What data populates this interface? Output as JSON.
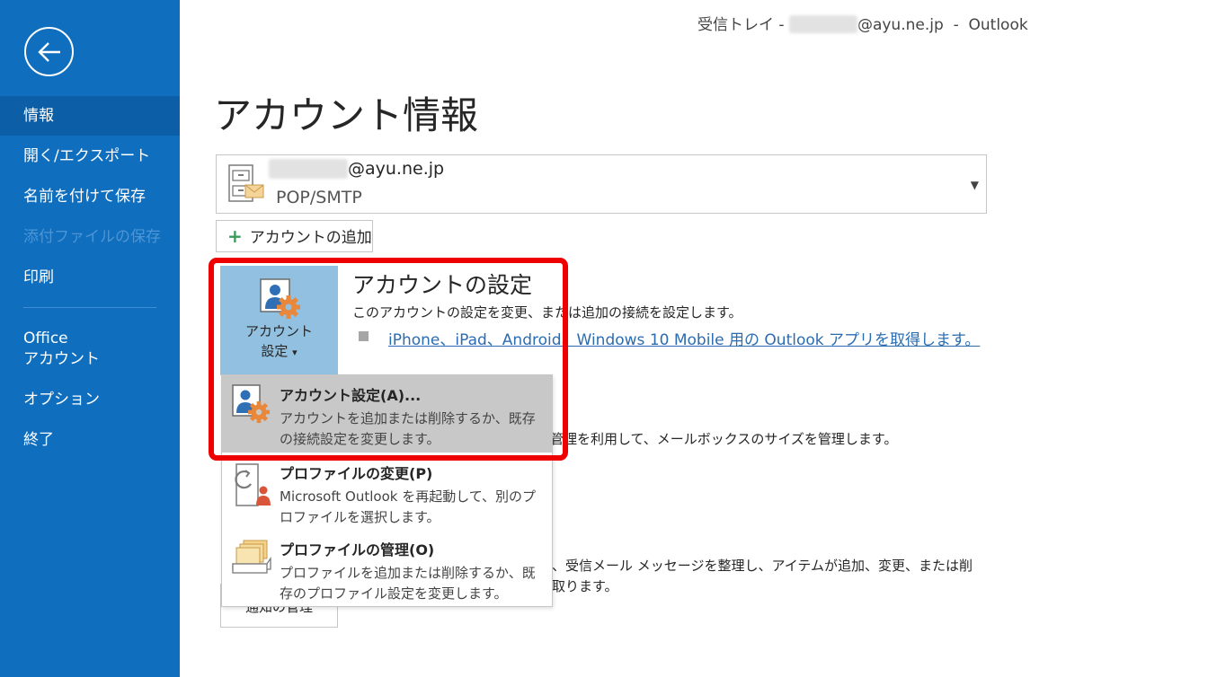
{
  "window": {
    "title_prefix": "受信トレイ - ",
    "title_email_suffix": "@ayu.ne.jp",
    "title_separator": "  -  ",
    "title_app": "Outlook"
  },
  "sidebar": {
    "back_icon": "arrow-left-circle-icon",
    "items": [
      {
        "label": "情報",
        "selected": true
      },
      {
        "label": "開く/エクスポート"
      },
      {
        "label": "名前を付けて保存"
      },
      {
        "label": "添付ファイルの保存",
        "disabled": true
      },
      {
        "label": "印刷"
      }
    ],
    "office_account": {
      "line1": "Office",
      "line2": "アカウント"
    },
    "options_label": "オプション",
    "exit_label": "終了",
    "colors": {
      "background": "#106ebe",
      "selected": "#0c5ea6",
      "disabled_text": "#4d95d4"
    }
  },
  "main": {
    "page_title": "アカウント情報",
    "account": {
      "email_suffix": "@ayu.ne.jp",
      "type": "POP/SMTP",
      "icon": "mailbox-file-icon",
      "caret_icon": "caret-down-icon",
      "caret_glyph": "▼"
    },
    "add_account": {
      "plus": "+",
      "label": "アカウントの追加"
    },
    "settings": {
      "button_line1": "アカウント",
      "button_line2": "設定",
      "button_caret": "▾",
      "heading": "アカウントの設定",
      "description": "このアカウントの設定を変更、または追加の接続を設定します。",
      "link": "iPhone、iPad、Android、Windows 10 Mobile 用の Outlook アプリを取得します。"
    },
    "background_texts": {
      "mailbox_desc": "管理を利用して、メールボックスのサイズを管理します。",
      "rules_desc_1": "、受信メール メッセージを整理し、アイテムが追加、変更、または削",
      "rules_desc_2": "取ります。",
      "alert_button": "通知の管理"
    }
  },
  "menu": {
    "items": [
      {
        "title": "アカウント設定(A)...",
        "description": "アカウントを追加または削除するか、既存の接続設定を変更します。",
        "icon": "account-settings-icon",
        "selected": true
      },
      {
        "title": "プロファイルの変更(P)",
        "description": "Microsoft Outlook を再起動して、別のプロファイルを選択します。",
        "icon": "profile-change-icon"
      },
      {
        "title": "プロファイルの管理(O)",
        "description": "プロファイルを追加または削除するか、既存のプロファイル設定を変更します。",
        "icon": "profile-manage-icon"
      }
    ]
  },
  "highlight": {
    "color": "#ee0000"
  }
}
